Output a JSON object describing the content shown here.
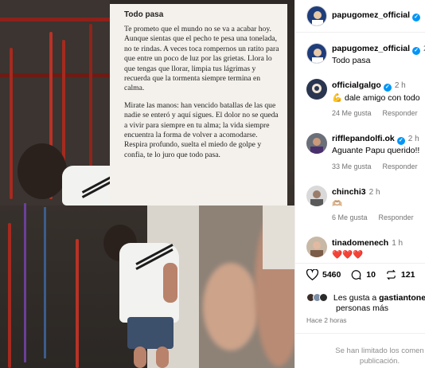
{
  "post": {
    "card_title": "Todo pasa",
    "card_paragraphs": [
      "Te prometo que el mundo no se va a acabar hoy. Aunque sientas que el pecho te pesa una tonelada, no te rindas. A veces toca rompernos un ratito para que entre un poco de luz por las grietas. Llora lo que tengas que llorar, limpia tus lágrimas y recuerda que la tormenta siempre termina en calma.",
      "Mirate las manos: han vencido batallas de las que nadie se enteró y aquí sigues. El dolor no se queda a vivir para siempre en tu alma; la vida siempre encuentra la forma de volver a acomodarse. Respira profundo, suelta el miedo de golpe y confia, te lo juro que todo pasa."
    ]
  },
  "header": {
    "username": "papugomez_official"
  },
  "caption": {
    "username": "papugomez_official",
    "time": "2",
    "text": "Todo pasa"
  },
  "comments": [
    {
      "username": "officialgalgo",
      "time": "2 h",
      "text": "💪 dale amigo con todo",
      "likes": "24 Me gusta",
      "reply": "Responder"
    },
    {
      "username": "rifflepandolfi.ok",
      "time": "2 h",
      "text": "Aguante Papu querido!!",
      "likes": "33 Me gusta",
      "reply": "Responder"
    },
    {
      "username": "chinchi3",
      "time": "2 h",
      "text": "🫶🏼",
      "likes": "6 Me gusta",
      "reply": "Responder"
    },
    {
      "username": "tinadomenech",
      "time": "1 h",
      "text": "❤️❤️❤️"
    }
  ],
  "actions": {
    "likes": "5460",
    "comments": "10",
    "reposts": "121"
  },
  "liked_by": {
    "prefix": "Les gusta a",
    "name": "gastiantone",
    "suffix": "personas más"
  },
  "posted_ago": "Hace 2 horas",
  "comments_limited": {
    "line1": "Se han limitado los comen",
    "line2": "publicación."
  },
  "colors": {
    "verified": "#0095f6",
    "meta_gray": "#737373",
    "card_bg": "#f4f1ec"
  }
}
